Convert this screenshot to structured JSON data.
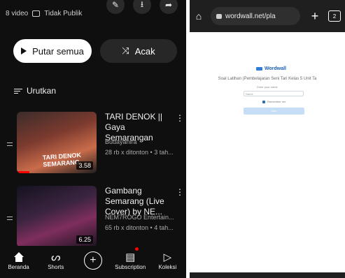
{
  "youtube": {
    "meta": {
      "video_count": "8 video",
      "privacy": "Tidak Publik"
    },
    "top_icons": [
      "pencil-icon",
      "download-icon",
      "share-icon"
    ],
    "buttons": {
      "play_all": "Putar semua",
      "shuffle": "Acak"
    },
    "sort_label": "Urutkan",
    "videos": [
      {
        "title": "TARI DENOK || Gaya Semarangan",
        "channel": "Budayanira",
        "stats": "28 rb x ditonton • 3 tah...",
        "duration": "3.58",
        "thumb_text": "TARI DENOK SEMARANG"
      },
      {
        "title": "Gambang Semarang (Live Cover) by NE...",
        "channel": "NEM7ROGO Entertain...",
        "stats": "65 rb x ditonton • 4 tah...",
        "duration": "6.25"
      }
    ],
    "nav": [
      {
        "label": "Beranda",
        "icon": "home-icon"
      },
      {
        "label": "Shorts",
        "icon": "shorts-icon"
      },
      {
        "label": "",
        "icon": "create-plus-icon"
      },
      {
        "label": "Subscription",
        "icon": "subscriptions-icon"
      },
      {
        "label": "Koleksi",
        "icon": "library-icon"
      }
    ],
    "accent_color": "#ff0000"
  },
  "browser": {
    "url": "wordwall.net/pla",
    "tab_count": "2"
  },
  "wordwall": {
    "logo_text": "Wordwall",
    "title": "Soal Latihan (Pembelajaran Seni Tari Kelas 5 Unit Ta",
    "enter_name_label": "Enter your name",
    "name_placeholder": "Name",
    "remember_label": "Remember me",
    "start_button": "Start"
  }
}
